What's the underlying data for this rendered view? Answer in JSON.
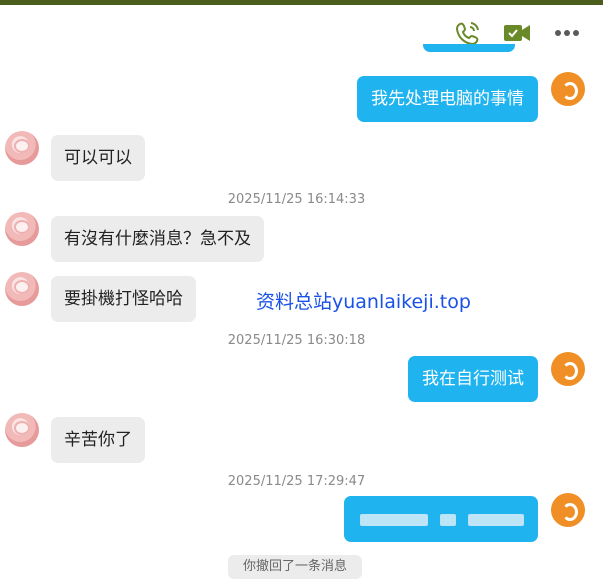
{
  "toolbar": {
    "icons": [
      "phone-call-icon",
      "video-call-icon",
      "more-options-icon"
    ],
    "accent": "#6a8a2a"
  },
  "messages": [
    {
      "side": "right",
      "text": "我先处理电脑的事情"
    },
    {
      "side": "left",
      "text": "可以可以"
    },
    {
      "side": "left",
      "text": "有沒有什麼消息？急不及"
    },
    {
      "side": "left",
      "text": "要掛機打怪哈哈"
    },
    {
      "side": "right",
      "text": "我在自行测试"
    },
    {
      "side": "left",
      "text": "辛苦你了"
    },
    {
      "side": "right",
      "text": ""
    }
  ],
  "timestamps": [
    "2025/11/25 16:14:33",
    "2025/11/25 16:30:18",
    "2025/11/25 17:29:47"
  ],
  "watermark": "资料总站yuanlaikeji.top",
  "recall_notice": "你撤回了一条消息",
  "colors": {
    "bubble_right": "#1fb3ef",
    "bubble_left": "#ececec",
    "avatar_right": "#ef8f25"
  }
}
